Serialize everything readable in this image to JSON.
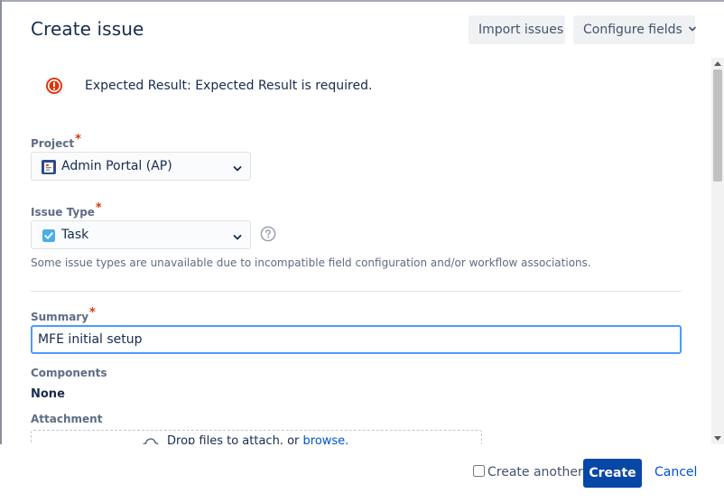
{
  "header": {
    "title": "Create issue",
    "import_label": "Import issues",
    "configure_label": "Configure fields"
  },
  "error": {
    "message": "Expected Result: Expected Result is required.",
    "icon": "error-circle-icon",
    "color": "#de350b"
  },
  "fields": {
    "project": {
      "label": "Project",
      "required_mark": "*",
      "value": "Admin Portal (AP)",
      "icon": "project-avatar-icon"
    },
    "issue_type": {
      "label": "Issue Type",
      "required_mark": "*",
      "value": "Task",
      "icon": "task-checkbox-icon",
      "hint": "Some issue types are unavailable due to incompatible field configuration and/or workflow associations."
    },
    "summary": {
      "label": "Summary",
      "required_mark": "*",
      "value": "MFE initial setup"
    },
    "components": {
      "label": "Components",
      "value": "None"
    },
    "attachment": {
      "label": "Attachment",
      "drop_text": "Drop files to attach, or",
      "browse_text": "browse."
    }
  },
  "footer": {
    "create_another_label": "Create another",
    "create_another_checked": false,
    "create_label": "Create",
    "cancel_label": "Cancel"
  },
  "colors": {
    "primary": "#0747a6",
    "link": "#0052cc",
    "text": "#172b4d",
    "subtle_text": "#5e6c84",
    "focus_border": "#4c9aff",
    "required": "#de350b"
  }
}
